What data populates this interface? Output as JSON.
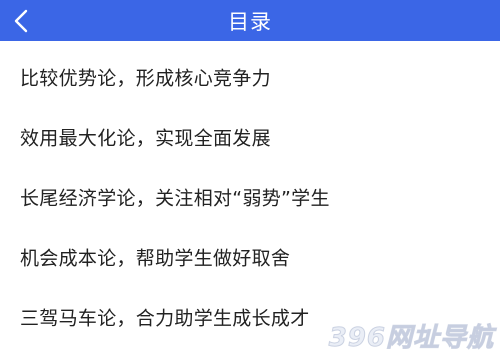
{
  "header": {
    "title": "目录",
    "back_icon": "chevron-left-icon",
    "background": "#3b66e6"
  },
  "items": [
    {
      "label": "比较优势论，形成核心竞争力"
    },
    {
      "label": "效用最大化论，实现全面发展"
    },
    {
      "label": "长尾经济学论，关注相对“弱势”学生"
    },
    {
      "label": "机会成本论，帮助学生做好取舍"
    },
    {
      "label": "三驾马车论，合力助学生成长成才"
    }
  ],
  "watermark": {
    "text": "396网址导航"
  }
}
